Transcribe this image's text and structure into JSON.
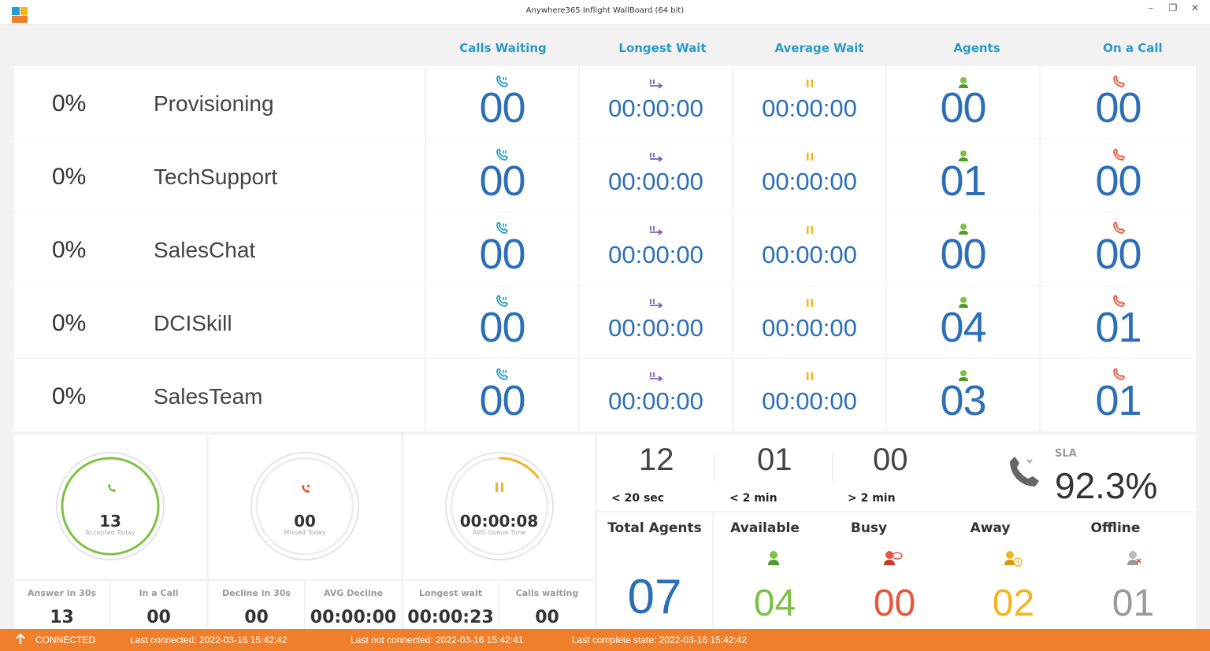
{
  "window": {
    "title": "Anywhere365 Inflight WallBoard (64 bit)"
  },
  "colors": {
    "accent": "#2a9bc4",
    "value": "#2c6fb8",
    "green": "#7dc243",
    "red": "#e8553a",
    "yellow": "#f2b51f",
    "gray": "#999999",
    "status": "#f07f2b"
  },
  "columns": [
    "Calls Waiting",
    "Longest Wait",
    "Average Wait",
    "Agents",
    "On a Call"
  ],
  "queues": [
    {
      "sla": "0%",
      "name": "Provisioning",
      "calls_waiting": "00",
      "longest_wait": "00:00:00",
      "average_wait": "00:00:00",
      "agents": "00",
      "on_call": "00"
    },
    {
      "sla": "0%",
      "name": "TechSupport",
      "calls_waiting": "00",
      "longest_wait": "00:00:00",
      "average_wait": "00:00:00",
      "agents": "01",
      "on_call": "00"
    },
    {
      "sla": "0%",
      "name": "SalesChat",
      "calls_waiting": "00",
      "longest_wait": "00:00:00",
      "average_wait": "00:00:00",
      "agents": "00",
      "on_call": "00"
    },
    {
      "sla": "0%",
      "name": "DCISkill",
      "calls_waiting": "00",
      "longest_wait": "00:00:00",
      "average_wait": "00:00:00",
      "agents": "04",
      "on_call": "01"
    },
    {
      "sla": "0%",
      "name": "SalesTeam",
      "calls_waiting": "00",
      "longest_wait": "00:00:00",
      "average_wait": "00:00:00",
      "agents": "03",
      "on_call": "01"
    }
  ],
  "stats": {
    "accepted": {
      "value": "13",
      "label": "Accepted Today",
      "icon": "phone-accepted-icon"
    },
    "missed": {
      "value": "00",
      "label": "Missed Today",
      "icon": "phone-missed-icon"
    },
    "avg_queue": {
      "value": "00:00:08",
      "label": "AVG Queue Time",
      "icon": "pause-icon",
      "progress": 0.15
    },
    "answer_30s": {
      "label": "Answer in 30s",
      "value": "13"
    },
    "in_call": {
      "label": "In a Call",
      "value": "00"
    },
    "decline_30s": {
      "label": "Decline in 30s",
      "value": "00"
    },
    "avg_decline": {
      "label": "AVG Decline",
      "value": "00:00:00"
    },
    "longest_wait": {
      "label": "Longest wait",
      "value": "00:00:23"
    },
    "calls_waiting": {
      "label": "Calls waiting",
      "value": "00"
    }
  },
  "sla": {
    "under_20": {
      "value": "12",
      "label": "< 20 sec"
    },
    "under_2m": {
      "value": "01",
      "label": "< 2 min"
    },
    "over_2m": {
      "value": "00",
      "label": "> 2 min"
    },
    "label": "SLA",
    "value": "92.3%"
  },
  "agents": {
    "total": {
      "label": "Total Agents",
      "value": "07"
    },
    "available": {
      "label": "Available",
      "value": "04"
    },
    "busy": {
      "label": "Busy",
      "value": "00"
    },
    "away": {
      "label": "Away",
      "value": "02"
    },
    "offline": {
      "label": "Offline",
      "value": "01"
    }
  },
  "status": {
    "connection": "CONNECTED",
    "last_connected": "Last connected: 2022-03-16 15:42:42",
    "last_not_connected": "Last not connected: 2022-03-16 15:42:41",
    "last_complete": "Last complete state: 2022-03-16 15:42:42"
  }
}
